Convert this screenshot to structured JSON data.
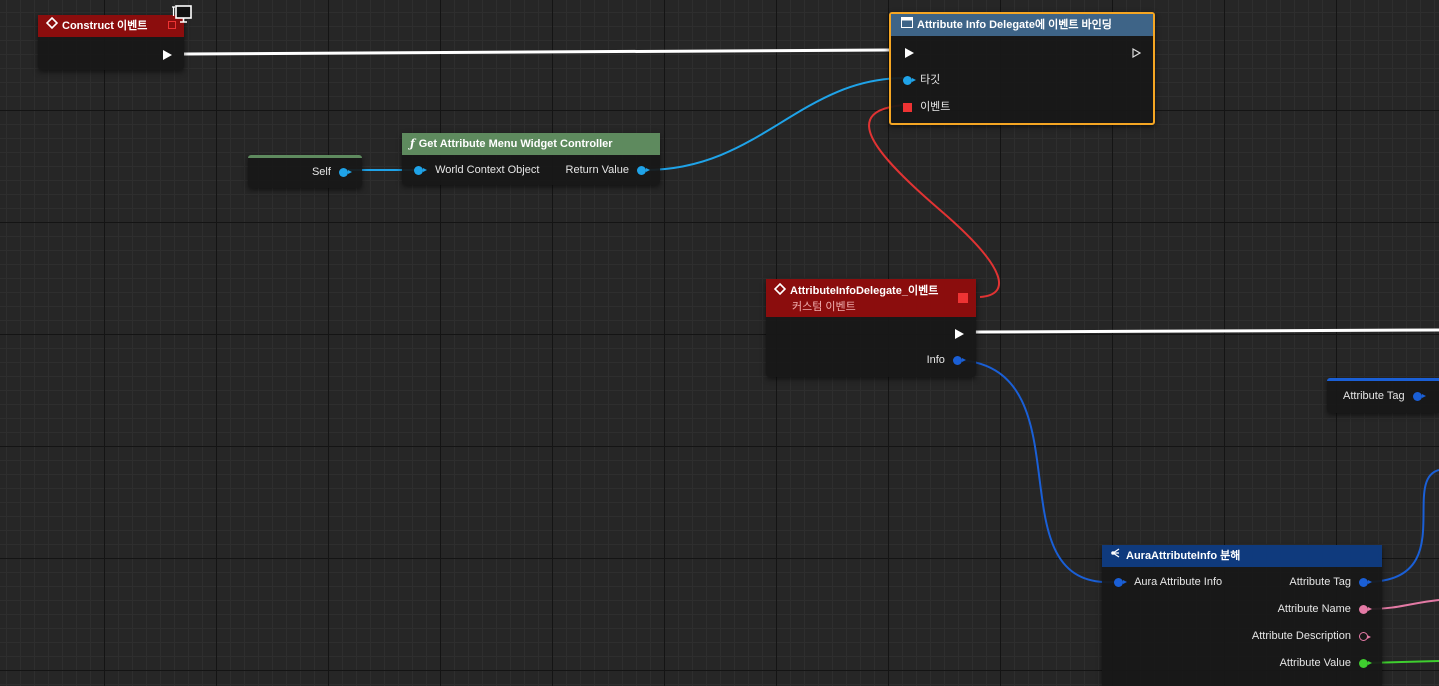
{
  "colors": {
    "exec_wire": "#ffffff",
    "object_wire": "#1fa3e8",
    "delegate_wire": "#e13333",
    "struct_wire": "#1a5fd6",
    "string_wire": "#e47aa5",
    "float_wire": "#3fcf2f",
    "event_header": "#8b0d0d",
    "function_header": "#5e8a5e",
    "bind_header": "#3e6487",
    "break_header": "#0f3a7d",
    "selection_outline": "#f5a623"
  },
  "construct_node": {
    "title": "Construct 이벤트"
  },
  "self_node": {
    "pin": "Self"
  },
  "get_controller_node": {
    "title": "Get Attribute Menu Widget Controller",
    "input_pin": "World Context Object",
    "output_pin": "Return Value"
  },
  "bind_node": {
    "title": "Attribute Info Delegate에 이벤트 바인딩",
    "target_pin": "타깃",
    "event_pin": "이벤트"
  },
  "custom_event_node": {
    "title": "AttributeInfoDelegate_이벤트",
    "subtitle": "커스텀 이벤트",
    "output_pin": "Info"
  },
  "attribute_tag_node": {
    "pin": "Attribute Tag"
  },
  "break_node": {
    "title": "AuraAttributeInfo 분해",
    "input_pin": "Aura Attribute Info",
    "outputs": [
      "Attribute Tag",
      "Attribute Name",
      "Attribute Description",
      "Attribute Value"
    ]
  }
}
